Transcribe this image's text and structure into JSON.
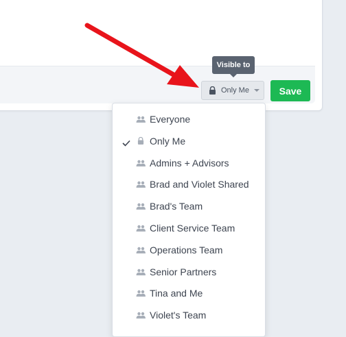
{
  "footer": {
    "visibility_button": {
      "label": "Only Me",
      "icon": "lock-icon"
    },
    "save_label": "Save"
  },
  "tooltip": {
    "text": "Visible to"
  },
  "dropdown": {
    "selected": "Only Me",
    "items": [
      {
        "label": "Everyone",
        "icon": "group-icon",
        "checked": false
      },
      {
        "label": "Only Me",
        "icon": "lock-icon",
        "checked": true
      },
      {
        "label": "Admins + Advisors",
        "icon": "group-icon",
        "checked": false
      },
      {
        "label": "Brad and Violet Shared",
        "icon": "group-icon",
        "checked": false
      },
      {
        "label": "Brad's Team",
        "icon": "group-icon",
        "checked": false
      },
      {
        "label": "Client Service Team",
        "icon": "group-icon",
        "checked": false
      },
      {
        "label": "Operations Team",
        "icon": "group-icon",
        "checked": false
      },
      {
        "label": "Senior Partners",
        "icon": "group-icon",
        "checked": false
      },
      {
        "label": "Tina and Me",
        "icon": "group-icon",
        "checked": false
      },
      {
        "label": "Violet's Team",
        "icon": "group-icon",
        "checked": false
      }
    ]
  },
  "colors": {
    "save": "#1db954",
    "tooltip": "#5a6370",
    "arrow": "#e8141b",
    "icon": "#a7aeb8"
  }
}
